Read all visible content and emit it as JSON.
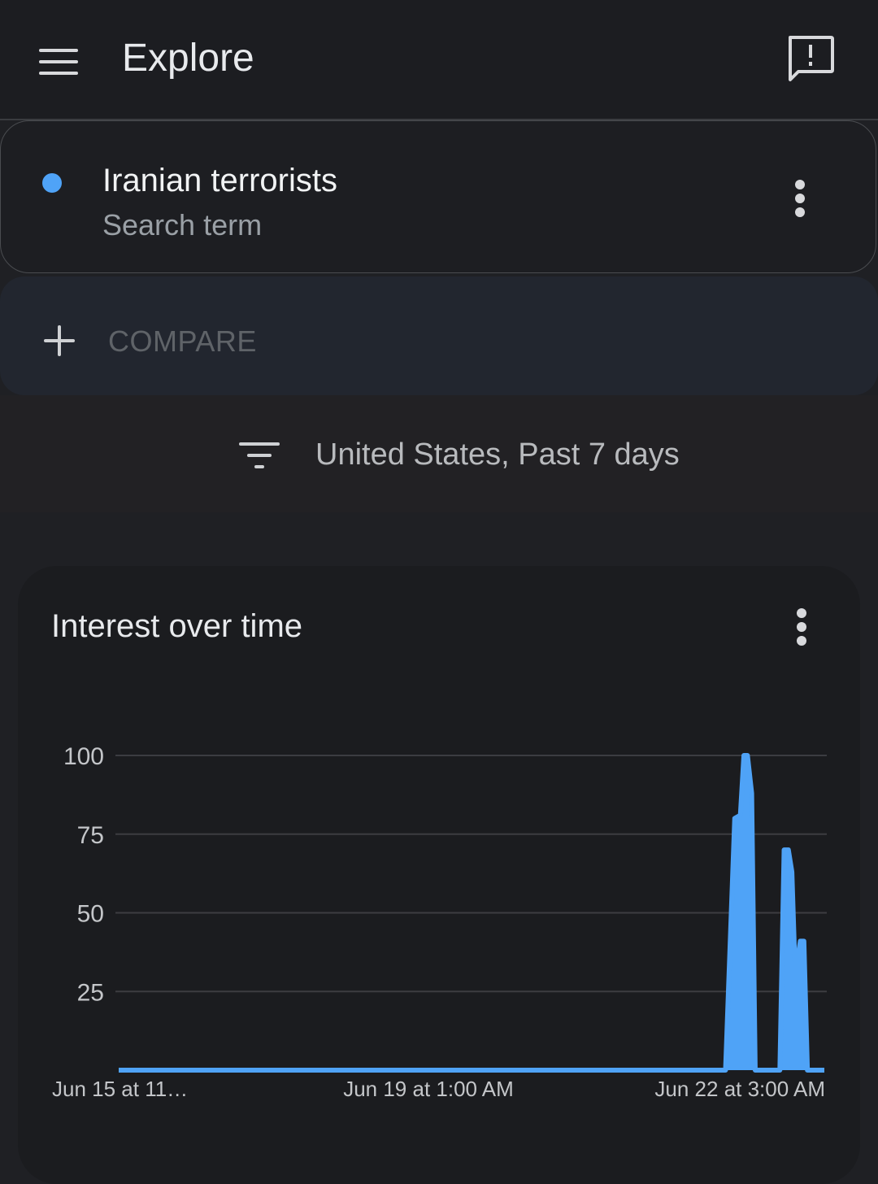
{
  "appbar": {
    "title": "Explore",
    "menu_icon": "menu-icon",
    "feedback_icon": "feedback-icon"
  },
  "search_term": {
    "name": "Iranian terrorists",
    "type": "Search term",
    "color": "#4fa3f7",
    "more_icon": "more-vert-icon"
  },
  "compare": {
    "label": "COMPARE",
    "icon": "plus-icon"
  },
  "filter": {
    "label": "United States, Past 7 days",
    "icon": "filter-icon"
  },
  "chart_card": {
    "title": "Interest over time",
    "more_icon": "more-vert-icon"
  },
  "chart_data": {
    "type": "area",
    "title": "Interest over time",
    "series": [
      {
        "color": "#4fa3f7",
        "points": [
          [
            0,
            0
          ],
          [
            0.86,
            0
          ],
          [
            0.873,
            80
          ],
          [
            0.881,
            81
          ],
          [
            0.886,
            100
          ],
          [
            0.891,
            100
          ],
          [
            0.897,
            88
          ],
          [
            0.902,
            0
          ],
          [
            0.937,
            0
          ],
          [
            0.943,
            70
          ],
          [
            0.949,
            70
          ],
          [
            0.954,
            63
          ],
          [
            0.958,
            35
          ],
          [
            0.962,
            35
          ],
          [
            0.966,
            41
          ],
          [
            0.971,
            41
          ],
          [
            0.976,
            0
          ],
          [
            1,
            0
          ]
        ]
      }
    ],
    "x_tick_labels": [
      "Jun 15 at 11…",
      "Jun 19 at 1:00 AM",
      "Jun 22 at 3:00 AM"
    ],
    "y_ticks": [
      100,
      75,
      50,
      25
    ],
    "ylim": [
      0,
      100
    ],
    "grid": true,
    "legend": "none"
  }
}
